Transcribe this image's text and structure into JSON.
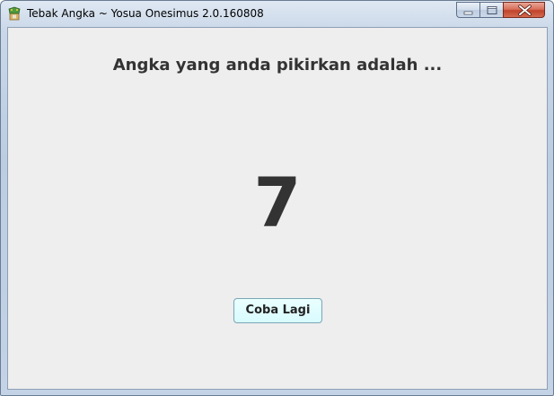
{
  "window": {
    "title": "Tebak Angka ~ Yosua Onesimus 2.0.160808",
    "controls": {
      "minimize_icon": "minimize-icon",
      "maximize_icon": "maximize-icon",
      "close_icon": "close-icon"
    },
    "app_icon": "app-icon"
  },
  "main": {
    "heading": "Angka yang anda pikirkan adalah ...",
    "result_number": "7",
    "retry_button_label": "Coba Lagi"
  },
  "colors": {
    "text": "#333333",
    "client_background": "#eeeeee",
    "button_background": "#d8fbff",
    "close_button": "#c0432a"
  }
}
